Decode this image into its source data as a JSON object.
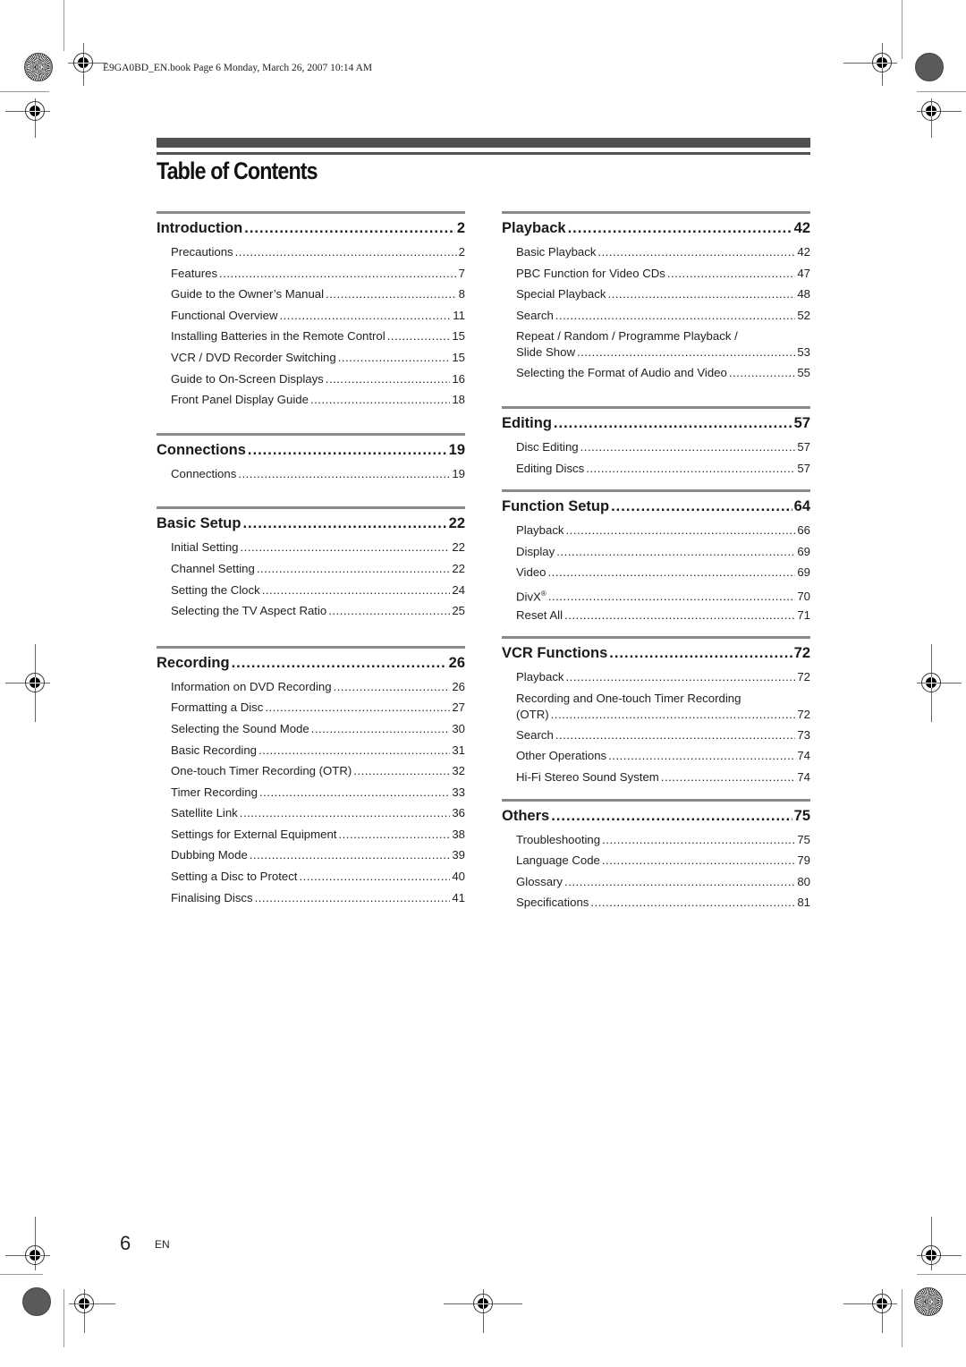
{
  "print_slug": "E9GA0BD_EN.book  Page 6  Monday, March 26, 2007  10:14 AM",
  "title": "Table of Contents",
  "left_column": [
    {
      "heading": "Introduction",
      "page": "2",
      "entries": [
        {
          "label": "Precautions",
          "page": "2"
        },
        {
          "label": "Features",
          "page": "7"
        },
        {
          "label": "Guide to the Owner’s Manual",
          "page": "8"
        },
        {
          "label": "Functional Overview",
          "page": "11"
        },
        {
          "label": "Installing Batteries in the Remote Control",
          "page": "15"
        },
        {
          "label": "VCR / DVD Recorder Switching",
          "page": "15"
        },
        {
          "label": "Guide to On-Screen Displays",
          "page": "16"
        },
        {
          "label": "Front Panel Display Guide",
          "page": "18"
        }
      ]
    },
    {
      "heading": "Connections",
      "page": "19",
      "entries": [
        {
          "label": "Connections",
          "page": "19"
        }
      ]
    },
    {
      "heading": "Basic Setup",
      "page": "22",
      "entries": [
        {
          "label": "Initial Setting",
          "page": "22"
        },
        {
          "label": "Channel Setting",
          "page": "22"
        },
        {
          "label": "Setting the Clock",
          "page": "24"
        },
        {
          "label": "Selecting the TV Aspect Ratio",
          "page": "25"
        }
      ]
    },
    {
      "heading": "Recording",
      "page": "26",
      "entries": [
        {
          "label": "Information on DVD Recording",
          "page": "26"
        },
        {
          "label": "Formatting a Disc",
          "page": "27"
        },
        {
          "label": "Selecting the Sound Mode",
          "page": "30"
        },
        {
          "label": "Basic Recording",
          "page": "31"
        },
        {
          "label": "One-touch Timer Recording (OTR)",
          "page": "32"
        },
        {
          "label": "Timer Recording",
          "page": "33"
        },
        {
          "label": "Satellite Link",
          "page": "36"
        },
        {
          "label": "Settings for External Equipment",
          "page": "38"
        },
        {
          "label": "Dubbing Mode",
          "page": "39"
        },
        {
          "label": "Setting a Disc to Protect",
          "page": "40"
        },
        {
          "label": "Finalising Discs",
          "page": "41"
        }
      ]
    }
  ],
  "right_column": [
    {
      "heading": "Playback",
      "page": "42",
      "entries": [
        {
          "label": "Basic Playback",
          "page": "42"
        },
        {
          "label": "PBC Function for Video CDs",
          "page": "47"
        },
        {
          "label": "Special Playback",
          "page": "48"
        },
        {
          "label": "Search",
          "page": "52"
        },
        {
          "label": "Repeat / Random / Programme Playback /",
          "label2": "Slide Show",
          "page": "53"
        },
        {
          "label": "Selecting the Format of Audio and Video",
          "page": "55"
        }
      ]
    },
    {
      "heading": "Editing",
      "page": "57",
      "entries": [
        {
          "label": "Disc Editing",
          "page": "57"
        },
        {
          "label": "Editing Discs",
          "page": "57"
        }
      ]
    },
    {
      "heading": "Function Setup",
      "page": "64",
      "entries": [
        {
          "label": "Playback",
          "page": "66"
        },
        {
          "label": "Display",
          "page": "69"
        },
        {
          "label": "Video",
          "page": "69"
        },
        {
          "label": "DivX",
          "sup": "®",
          "page": "70"
        },
        {
          "label": "Reset All",
          "page": "71"
        }
      ]
    },
    {
      "heading": "VCR Functions",
      "page": "72",
      "entries": [
        {
          "label": "Playback",
          "page": "72"
        },
        {
          "label": "Recording and One-touch Timer Recording",
          "label2": "(OTR)",
          "page": "72"
        },
        {
          "label": "Search",
          "page": "73"
        },
        {
          "label": "Other Operations",
          "page": "74"
        },
        {
          "label": "Hi-Fi Stereo Sound System",
          "page": "74"
        }
      ]
    },
    {
      "heading": "Others",
      "page": "75",
      "entries": [
        {
          "label": "Troubleshooting",
          "page": "75"
        },
        {
          "label": "Language Code",
          "page": "79"
        },
        {
          "label": "Glossary",
          "page": "80"
        },
        {
          "label": "Specifications",
          "page": "81"
        }
      ]
    }
  ],
  "footer": {
    "page_number": "6",
    "language": "EN"
  }
}
